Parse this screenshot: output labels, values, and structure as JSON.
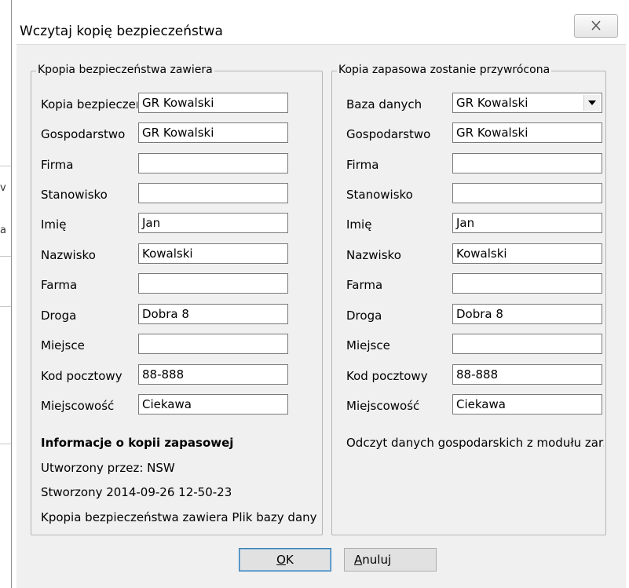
{
  "window": {
    "title": "Wczytaj kopię bezpieczeństwa"
  },
  "left_group": {
    "title": "Kpopia bezpieczeństwa zawiera",
    "rows": [
      {
        "label": "Kopia bezpieczeń",
        "value": "GR Kowalski"
      },
      {
        "label": "Gospodarstwo",
        "value": "GR Kowalski"
      },
      {
        "label": "Firma",
        "value": ""
      },
      {
        "label": "Stanowisko",
        "value": ""
      },
      {
        "label": "Imię",
        "value": "Jan"
      },
      {
        "label": "Nazwisko",
        "value": "Kowalski"
      },
      {
        "label": "Farma",
        "value": ""
      },
      {
        "label": "Droga",
        "value": "Dobra 8"
      },
      {
        "label": "Miejsce",
        "value": ""
      },
      {
        "label": "Kod pocztowy",
        "value": "88-888"
      },
      {
        "label": "Miejscowość",
        "value": "Ciekawa"
      }
    ],
    "info": {
      "heading": "Informacje o kopii zapasowej",
      "created_by": "Utworzony przez: NSW",
      "created_on": "Stworzony 2014-09-26 12-50-23",
      "contains": "Kpopia bezpieczeństwa zawiera Plik bazy dany"
    }
  },
  "right_group": {
    "title": "Kopia zapasowa zostanie przywrócona",
    "rows": [
      {
        "label": "Baza danych",
        "value": "GR Kowalski"
      },
      {
        "label": "Gospodarstwo",
        "value": "GR Kowalski"
      },
      {
        "label": "Firma",
        "value": ""
      },
      {
        "label": "Stanowisko",
        "value": ""
      },
      {
        "label": "Imię",
        "value": "Jan"
      },
      {
        "label": "Nazwisko",
        "value": "Kowalski"
      },
      {
        "label": "Farma",
        "value": ""
      },
      {
        "label": "Droga",
        "value": "Dobra 8"
      },
      {
        "label": "Miejsce",
        "value": ""
      },
      {
        "label": "Kod pocztowy",
        "value": "88-888"
      },
      {
        "label": "Miejscowość",
        "value": "Ciekawa"
      }
    ],
    "note": "Odczyt danych gospodarskich z modułu zarzą"
  },
  "buttons": {
    "ok_mnemonic": "O",
    "ok_rest": "K",
    "cancel_mnemonic": "A",
    "cancel_rest": "nuluj"
  },
  "background_app": {
    "glyph_1": "v",
    "glyph_2": "a"
  },
  "icons": {
    "close": "close-icon",
    "dropdown": "chevron-down-icon"
  }
}
